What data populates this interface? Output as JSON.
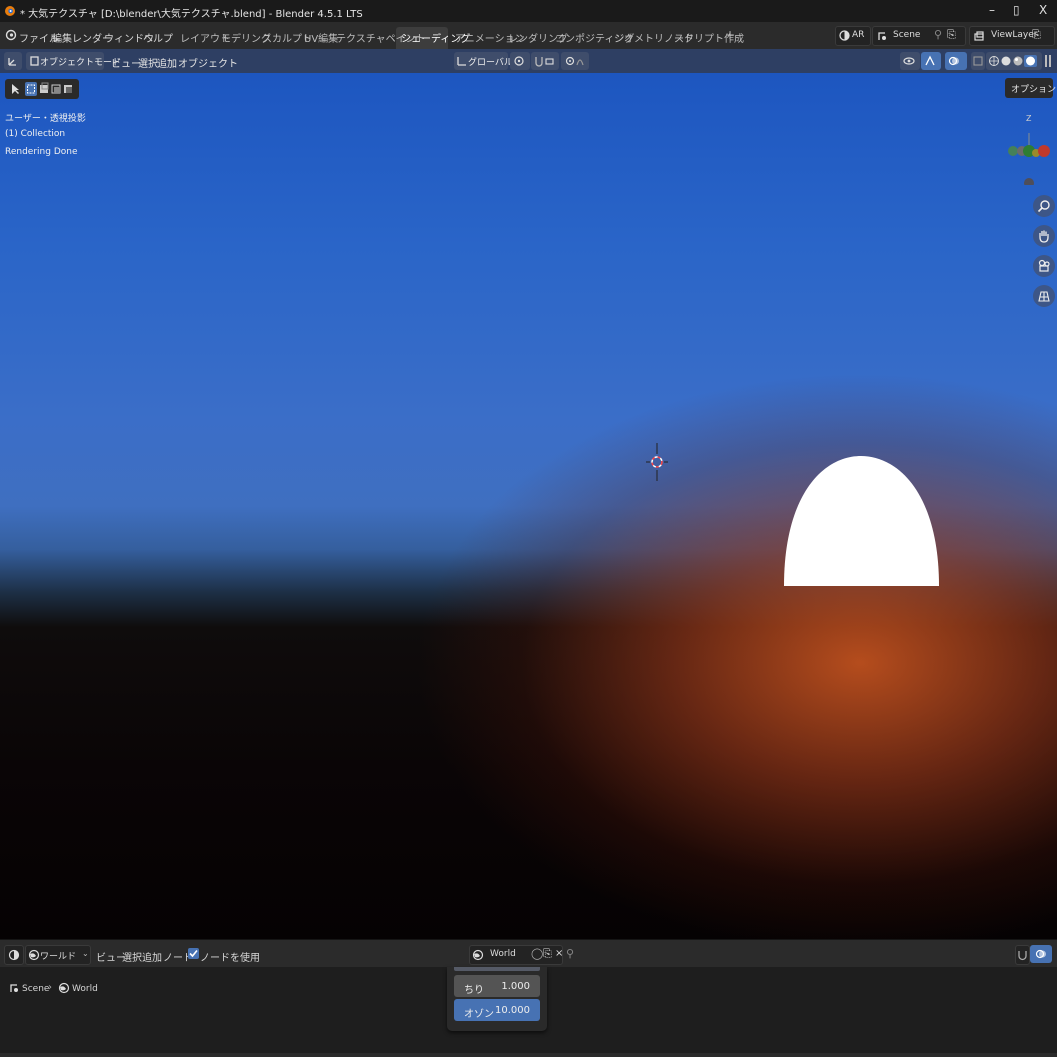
{
  "window": {
    "title": "* 大気テクスチャ [D:\\blender\\大気テクスチャ.blend] - Blender 4.5.1 LTS",
    "minimize": "–",
    "maximize": "▯",
    "close": "X"
  },
  "menu": [
    "ファイル",
    "編集",
    "レンダー",
    "ウィンドウ",
    "ヘルプ"
  ],
  "workspaces": {
    "tabs": [
      "レイアウト",
      "モデリング",
      "スカルプト",
      "UV編集",
      "テクスチャペイント",
      "シェーディング",
      "アニメーション",
      "レンダリング",
      "コンポジティング",
      "ジオメトリノード",
      "スクリプト作成"
    ],
    "active": "シェーディング",
    "add": "+"
  },
  "topright": {
    "ar_label": "AR",
    "scene": "Scene",
    "view_layer": "ViewLayer"
  },
  "viewport_header": {
    "mode": "オブジェクトモード",
    "menus": [
      "ビュー",
      "選択",
      "追加",
      "オブジェクト"
    ],
    "transform_orientation": "グローバル",
    "options": "オプション"
  },
  "viewport_overlay": {
    "view_name": "ユーザー・透視投影",
    "collection": "(1) Collection",
    "status": "Rendering Done",
    "gizmo_axis": "Z"
  },
  "node_header": {
    "shader_type": "ワールド",
    "menus": [
      "ビュー",
      "選択",
      "追加",
      "ノード"
    ],
    "use_nodes_label": "ノードを使用",
    "use_nodes_checked": true,
    "world_name": "World"
  },
  "breadcrumb": {
    "scene": "Scene",
    "world": "World"
  },
  "panel": {
    "rows": [
      {
        "label": "ちり",
        "value": "1.000",
        "selected": false
      },
      {
        "label": "オゾン",
        "value": "10.000",
        "selected": true
      }
    ]
  },
  "colors": {
    "accent": "#4772b3",
    "header_blue": "#2e3f63",
    "sun": "#ffffff",
    "sky_top": "#1d56c0",
    "horizon_glow": "#be501e"
  }
}
